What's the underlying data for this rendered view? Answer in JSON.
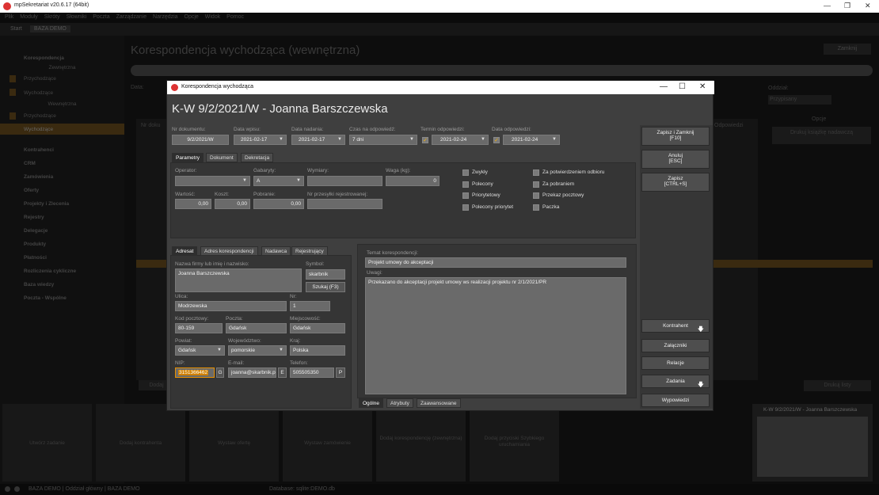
{
  "app": {
    "title": "mpSekretariat v20.6.17 (64bit)",
    "menu": [
      "Plik",
      "Moduły",
      "Skróty",
      "Słowniki",
      "Poczta",
      "Zarządzanie",
      "Narzędzia",
      "Opcje",
      "Widok",
      "Pomoc"
    ],
    "tabs": [
      "Start",
      "BAZA DEMO"
    ],
    "sidebar": {
      "header": "Korespondencja",
      "sub_header_1": "Zewnętrzna",
      "items_1": [
        "Przychodzące",
        "Wychodzące"
      ],
      "sub_header_2": "Wewnętrzna",
      "items_2": [
        "Przychodzące",
        "Wychodzące"
      ],
      "groups": [
        "Kontrahenci",
        "CRM",
        "Zamówienia",
        "Oferty",
        "Projekty i Zlecenia",
        "Rejestry",
        "Delegacje",
        "Produkty",
        "Płatności",
        "Rozliczenia cykliczne",
        "Baza wiedzy",
        "Poczta - Wspólne"
      ]
    },
    "background_title": "Korespondencja wychodząca (wewnętrzna)",
    "background_close": "Zamknij",
    "background_labels": {
      "data": "Data:",
      "nr_doku": "Nr doku",
      "odpowiedzi": "Odpowiedzi",
      "opcje": "Opcje",
      "drukuj_kopie": "Drukuj książkę nadawczą",
      "drukuj_listy": "Drukuj listy",
      "dodaj": "Dodaj",
      "oddzial": "Oddział:",
      "oddzial_value": "Przypisany"
    },
    "tiles": [
      "Utwórz zadanie",
      "Dodaj kontrahenta",
      "Wystaw ofertę",
      "Wystaw zamówienie",
      "Dodaj korespondencję (zewnętrzna)",
      "Dodaj przyciski Szybkiego uruchamiania"
    ],
    "preview_title": "K-W 9/2/2021/W - Joanna Barszczewska",
    "status": {
      "db": "BAZA DEMO | Oddział główny | BAZA DEMO",
      "server": "Database: sqlite:DEMO.db"
    }
  },
  "dialog": {
    "window_title": "Korespondencja wychodząca",
    "heading": "K-W 9/2/2021/W - Joanna Barszczewska",
    "header_fields": {
      "nr_dokumentu": {
        "label": "Nr dokumentu:",
        "value": "9/2/2021/W"
      },
      "data_wpisu": {
        "label": "Data wpisu:",
        "value": "2021-02-17"
      },
      "data_nadania": {
        "label": "Data nadania:",
        "value": "2021-02-17"
      },
      "czas_odpowiedzi": {
        "label": "Czas na odpowiedź:",
        "value": "7 dni"
      },
      "termin_odpowiedzi": {
        "label": "Termin odpowiedzi:",
        "value": "2021-02-24"
      },
      "data_odpowiedzi": {
        "label": "Data odpowiedzi:",
        "value": "2021-02-24"
      }
    },
    "top_tabs": [
      "Parametry",
      "Dokument",
      "Dekretacja"
    ],
    "parametry": {
      "operator": {
        "label": "Operator:",
        "value": ""
      },
      "gabaryty": {
        "label": "Gabaryty:",
        "value": "A"
      },
      "wymiary": {
        "label": "Wymiary:",
        "value": ""
      },
      "waga": {
        "label": "Waga (kg):",
        "value": "0"
      },
      "wartosc": {
        "label": "Wartość:",
        "value": "0,00"
      },
      "koszt": {
        "label": "Koszt:",
        "value": "0,00"
      },
      "pobranie": {
        "label": "Pobranie:",
        "value": "0,00"
      },
      "nr_przesylki": {
        "label": "Nr przesyłki rejestrowanej:",
        "value": ""
      },
      "checkboxes_left": [
        "Zwykły",
        "Polecony",
        "Priorytetowy",
        "Polecony priorytet"
      ],
      "checkboxes_right": [
        "Za potwierdzeniem odbioru",
        "Za pobraniem",
        "Przekaz pocztowy",
        "Paczka"
      ]
    },
    "bottom_tabs": [
      "Adresat",
      "Adres korespondencji",
      "Nadawca",
      "Rejestrujący"
    ],
    "adresat": {
      "nazwa": {
        "label": "Nazwa firmy lub imię i nazwisko:",
        "value": "Joanna Barszczewska"
      },
      "symbol": {
        "label": "Symbol:",
        "value": "skarbnik"
      },
      "szukaj": "Szukaj (F3)",
      "ulica": {
        "label": "Ulica:",
        "value": "Modrzewska"
      },
      "nr": {
        "label": "Nr:",
        "value": "1"
      },
      "kod": {
        "label": "Kod pocztowy:",
        "value": "80-159"
      },
      "poczta": {
        "label": "Poczta:",
        "value": "Gdańsk"
      },
      "miejscowosc": {
        "label": "Miejscowość:",
        "value": "Gdańsk"
      },
      "powiat": {
        "label": "Powiat:",
        "value": "Gdańsk"
      },
      "wojewodztwo": {
        "label": "Województwo:",
        "value": "pomorskie"
      },
      "kraj": {
        "label": "Kraj:",
        "value": "Polska"
      },
      "nip": {
        "label": "NIP:",
        "value": "3151366462",
        "btn": "G"
      },
      "email": {
        "label": "E-mail:",
        "value": "joanna@skarbnik.p",
        "btn": "E"
      },
      "telefon": {
        "label": "Telefon:",
        "value": "505505350",
        "btn": "P"
      }
    },
    "temat": {
      "label": "Temat korespondencji:",
      "value": "Projekt umowy do akceptacji"
    },
    "uwagi": {
      "label": "Uwagi:",
      "value": "Przekazano do akceptacji projekt umowy ws realizacji projektu nr 2/1/2021/PR"
    },
    "memo_tabs": [
      "Ogólne",
      "Atrybuty",
      "Zaawansowane"
    ],
    "buttons": {
      "save_close": "Zapisz i Zamknij",
      "save_close_key": "[F10]",
      "cancel": "Anuluj",
      "cancel_key": "[ESC]",
      "save": "Zapisz",
      "save_key": "[CTRL+S]",
      "kontrahent": "Kontrahent",
      "zalaczniki": "Załączniki",
      "relacje": "Relacje",
      "zadania": "Zadania",
      "wypowiedzi": "Wypowiedzi"
    }
  }
}
